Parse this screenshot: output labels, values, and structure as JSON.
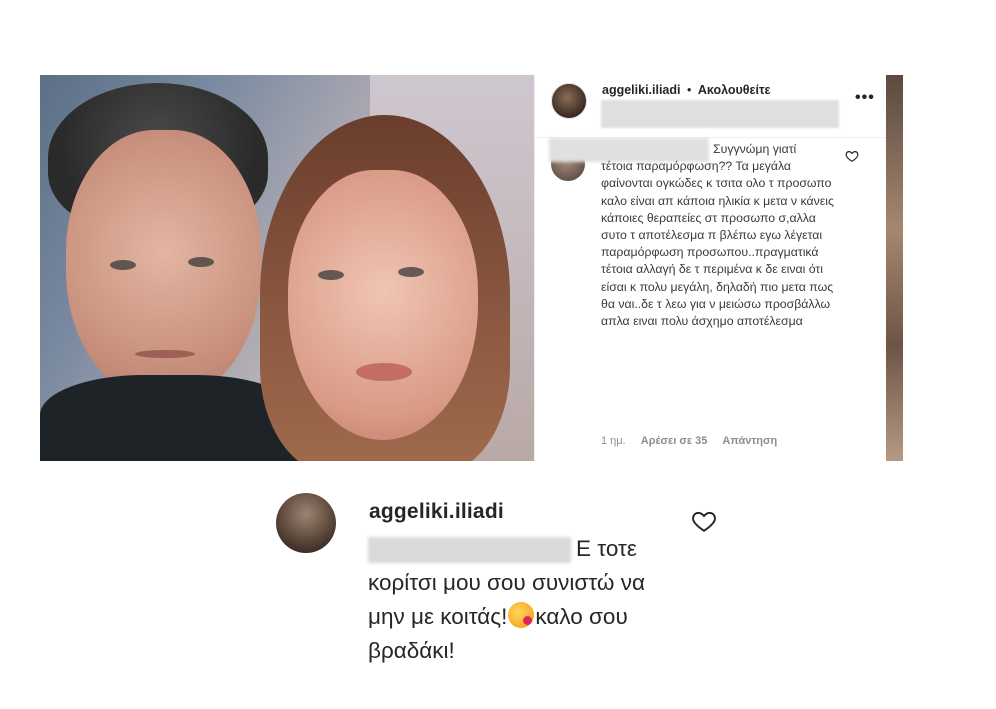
{
  "post": {
    "header": {
      "username": "aggeliki.iliadi",
      "separator": "•",
      "follow_status": "Ακολουθείτε"
    },
    "comment": {
      "first_line": "Συγγνώμη γιατί",
      "body": "τέτοια παραμόρφωση?? Τα μεγάλα φαίνονται ογκώδες κ τσιτα ολο τ προσωπο καλο είναι απ κάποια ηλικία κ μετα ν κάνεις κάποιες θεραπείες στ προσωπο σ,αλλα συτο τ αποτέλεσμα π βλέπω εγω λέγεται παραμόρφωση προσωπου..πραγματικά τέτοια αλλαγή δε τ περιμένα κ δε ειναι ότι είσαι κ πολυ μεγάλη, δηλαδή πιο μετα πως θα ναι..δε τ λεω για ν μειώσω προσβάλλω απλα ειναι πολυ άσχημο αποτέλεσμα",
      "time_ago": "1 ημ.",
      "likes": "Αρέσει σε 35",
      "reply_label": "Απάντηση"
    }
  },
  "reply": {
    "username": "aggeliki.iliadi",
    "first_line": "Ε τοτε",
    "text_before_emoji": "κορίτσι μου σου συνιστώ να μην με κοιτάς!",
    "text_after_emoji": "καλο σου βραδάκι!"
  }
}
